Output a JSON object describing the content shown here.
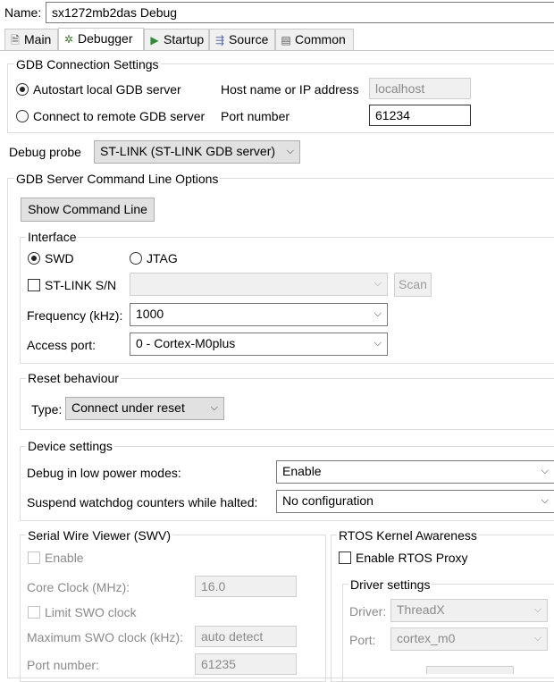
{
  "header": {
    "name_label": "Name:",
    "name_value": "sx1272mb2das Debug"
  },
  "tabs": [
    {
      "label": "Main",
      "icon": "page-icon"
    },
    {
      "label": "Debugger",
      "icon": "bug-icon"
    },
    {
      "label": "Startup",
      "icon": "play-icon"
    },
    {
      "label": "Source",
      "icon": "source-icon"
    },
    {
      "label": "Common",
      "icon": "common-icon"
    }
  ],
  "gdb": {
    "title": "GDB Connection Settings",
    "autostart": "Autostart local GDB server",
    "remote": "Connect to remote GDB server",
    "host_label": "Host name or IP address",
    "host_value": "localhost",
    "port_label": "Port number",
    "port_value": "61234"
  },
  "probe": {
    "label": "Debug probe",
    "value": "ST-LINK (ST-LINK GDB server)"
  },
  "server": {
    "title": "GDB Server Command Line Options",
    "show_cmd": "Show Command Line"
  },
  "interface": {
    "title": "Interface",
    "swd": "SWD",
    "jtag": "JTAG",
    "stlink_sn": "ST-LINK S/N",
    "scan": "Scan",
    "freq_label": "Frequency (kHz):",
    "freq_value": "1000",
    "access_label": "Access port:",
    "access_value": "0 - Cortex-M0plus"
  },
  "reset": {
    "title": "Reset behaviour",
    "type_label": "Type:",
    "type_value": "Connect under reset"
  },
  "device": {
    "title": "Device settings",
    "lowpower_label": "Debug in low power modes:",
    "lowpower_value": "Enable",
    "watchdog_label": "Suspend watchdog counters while halted:",
    "watchdog_value": "No configuration"
  },
  "swv": {
    "title": "Serial Wire Viewer (SWV)",
    "enable": "Enable",
    "core_clock_label": "Core Clock (MHz):",
    "core_clock_value": "16.0",
    "limit_swo": "Limit SWO clock",
    "max_swo_label": "Maximum SWO clock (kHz):",
    "max_swo_value": "auto detect",
    "port_label": "Port number:",
    "port_value": "61235"
  },
  "rtos": {
    "title": "RTOS Kernel Awareness",
    "enable_proxy": "Enable RTOS Proxy",
    "driver_settings": "Driver settings",
    "driver_label": "Driver:",
    "driver_value": "ThreadX",
    "port_label": "Port:",
    "port_value": "cortex_m0"
  }
}
